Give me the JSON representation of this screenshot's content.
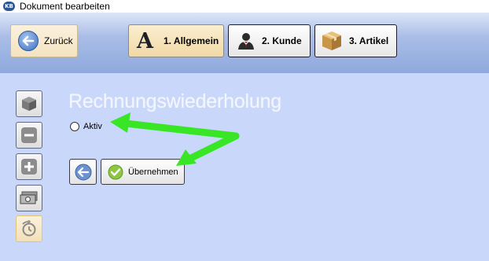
{
  "window": {
    "logo_text": "KB",
    "title": "Dokument bearbeiten"
  },
  "header": {
    "back_label": "Zurück",
    "tabs": [
      {
        "label": "1. Allgemein",
        "icon": "letter-a-icon",
        "active": true
      },
      {
        "label": "2. Kunde",
        "icon": "person-icon",
        "active": false
      },
      {
        "label": "3. Artikel",
        "icon": "box-icon",
        "active": false
      }
    ],
    "tab_a_glyph": "A"
  },
  "sidebar": {
    "items": [
      {
        "icon": "box-icon"
      },
      {
        "icon": "minus-icon"
      },
      {
        "icon": "plus-icon"
      },
      {
        "icon": "money-icon"
      },
      {
        "icon": "recurrence-clock-icon",
        "active": true
      }
    ]
  },
  "main": {
    "title": "Rechnungswiederholung",
    "active_label": "Aktiv",
    "active_checked": false,
    "apply_label": "Übernehmen"
  },
  "colors": {
    "header_top": "#dde6f8",
    "header_bottom": "#8fa9dd",
    "main_bg": "#c9d8fa",
    "annotation_arrow": "#39e626"
  }
}
